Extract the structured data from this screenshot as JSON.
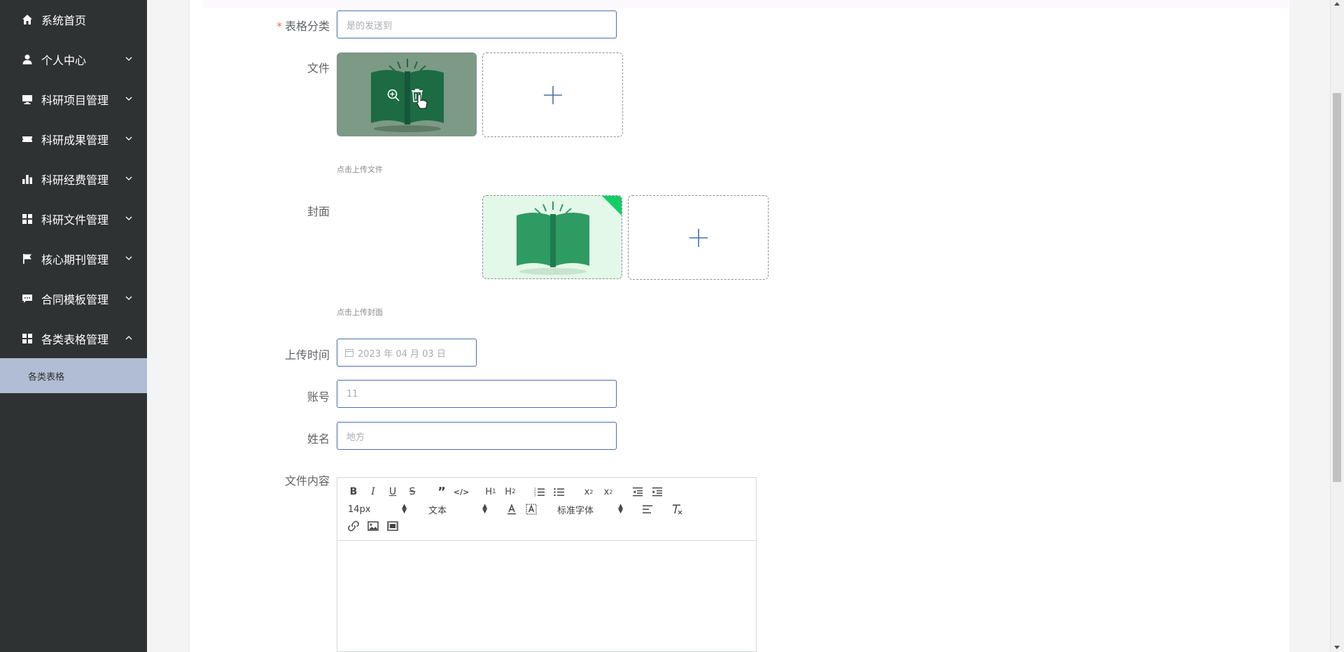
{
  "sidebar": {
    "items": [
      {
        "label": "系统首页",
        "icon": "home-icon",
        "expanded": null
      },
      {
        "label": "个人中心",
        "icon": "user-icon",
        "expanded": false
      },
      {
        "label": "科研项目管理",
        "icon": "monitor-icon",
        "expanded": false
      },
      {
        "label": "科研成果管理",
        "icon": "ticket-icon",
        "expanded": false
      },
      {
        "label": "科研经费管理",
        "icon": "bar-chart-icon",
        "expanded": false
      },
      {
        "label": "科研文件管理",
        "icon": "grid-icon",
        "expanded": false
      },
      {
        "label": "核心期刊管理",
        "icon": "flag-icon",
        "expanded": false
      },
      {
        "label": "合同模板管理",
        "icon": "message-icon",
        "expanded": false
      },
      {
        "label": "各类表格管理",
        "icon": "grid-icon",
        "expanded": true
      }
    ],
    "subitems": [
      {
        "label": "各类表格",
        "active": true
      }
    ]
  },
  "form": {
    "category": {
      "label": "表格分类",
      "required": true,
      "placeholder": "是的发送到"
    },
    "file": {
      "label": "文件",
      "hint": "点击上传文件"
    },
    "cover": {
      "label": "封面",
      "hint": "点击上传封面"
    },
    "upload_time": {
      "label": "上传时间",
      "value": "2023 年 04 月 03 日"
    },
    "account": {
      "label": "账号",
      "value": "11"
    },
    "name": {
      "label": "姓名",
      "value": "地方"
    },
    "content": {
      "label": "文件内容"
    }
  },
  "editor": {
    "font_size": "14px",
    "header_select": "文本",
    "font_family": "标准字体"
  },
  "colors": {
    "sidebar_bg": "#2f3233",
    "submenu_active_bg": "#b1bdd4",
    "input_border": "#4a6fb0",
    "book_green": "#2e9b62",
    "plus_blue": "#4a6fb0"
  }
}
